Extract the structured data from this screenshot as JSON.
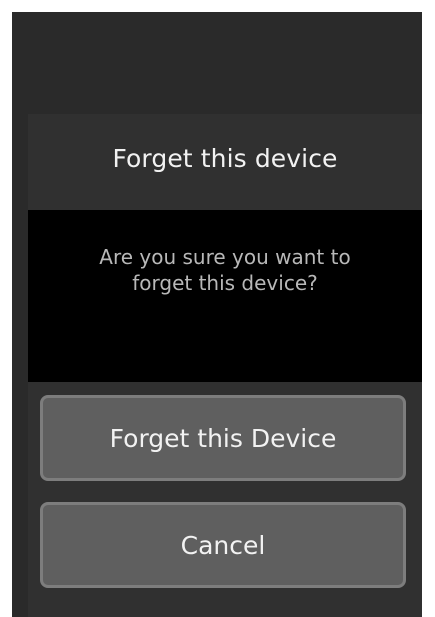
{
  "dialog": {
    "title": "Forget this device",
    "message": "Are you sure you want to forget this device?",
    "buttons": {
      "confirm_label": "Forget this Device",
      "cancel_label": "Cancel"
    }
  },
  "colors": {
    "screen_background": "#2a2a2a",
    "dialog_background": "#303030",
    "message_panel_background": "#000000",
    "button_background": "#5f5f5f",
    "button_border": "#7d7d7d",
    "text_primary": "#f2f2f2",
    "text_secondary": "#b8b8b8"
  }
}
